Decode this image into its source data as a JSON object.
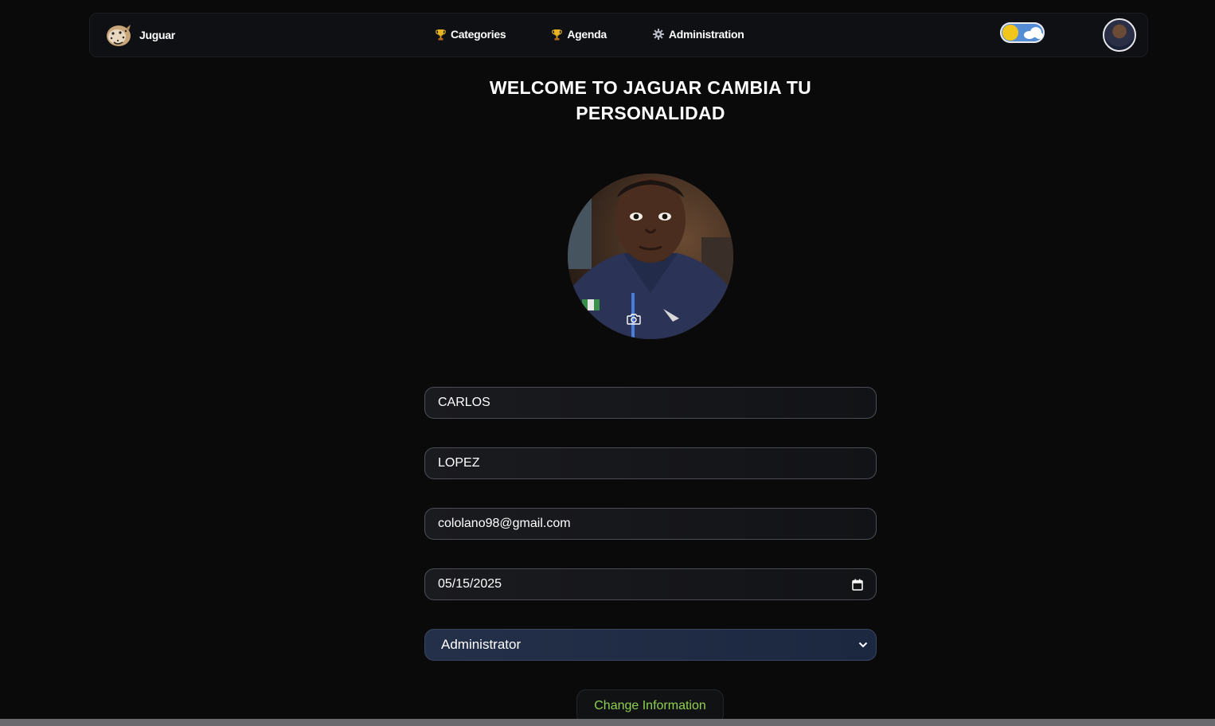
{
  "navbar": {
    "brand_name": "Juguar",
    "links": [
      {
        "label": "Categories",
        "icon": "trophy-icon"
      },
      {
        "label": "Agenda",
        "icon": "trophy-icon"
      },
      {
        "label": "Administration",
        "icon": "gear-icon"
      }
    ],
    "theme_toggle": {
      "state": "light",
      "icon": "sun-cloud-icon"
    },
    "avatar_icon": "user-avatar"
  },
  "main": {
    "title": "WELCOME TO JAGUAR CAMBIA TU PERSONALIDAD",
    "profile_photo_icon": "camera-icon"
  },
  "form": {
    "first_name": "CARLOS",
    "last_name": "LOPEZ",
    "email": "cololano98@gmail.com",
    "birth_date": "05/15/2025",
    "role": "Administrator",
    "submit_label": "Change Information"
  },
  "colors": {
    "background": "#0a0a0b",
    "button_text": "#8fd14f",
    "select_bg": "#243049",
    "toggle_sun": "#f2c51b"
  }
}
